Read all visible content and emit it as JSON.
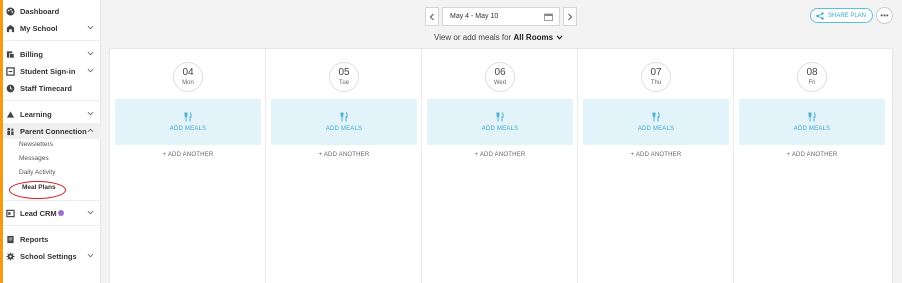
{
  "sidebar": {
    "items": [
      {
        "label": "Dashboard",
        "icon": "palette-icon"
      },
      {
        "label": "My School",
        "icon": "school-icon"
      },
      {
        "label": "Billing",
        "icon": "billing-icon"
      },
      {
        "label": "Student Sign-in",
        "icon": "signin-icon"
      },
      {
        "label": "Staff Timecard",
        "icon": "clock-icon"
      },
      {
        "label": "Learning",
        "icon": "learning-icon"
      },
      {
        "label": "Parent Connection",
        "icon": "family-icon"
      },
      {
        "label": "Lead CRM",
        "icon": "crm-icon"
      },
      {
        "label": "Reports",
        "icon": "reports-icon"
      },
      {
        "label": "School Settings",
        "icon": "gear-icon"
      }
    ],
    "sub_items": [
      "Newsletters",
      "Messages",
      "Daily Activity",
      "Meal Plans"
    ],
    "accent_color": "#f39c12"
  },
  "header": {
    "date_range": "May 4 - May 10",
    "view_prefix": "View or add meals for",
    "room_selection": "All Rooms",
    "share_label": "SHARE PLAN",
    "more_label": "•••"
  },
  "days": [
    {
      "number": "04",
      "name": "Mon"
    },
    {
      "number": "05",
      "name": "Tue"
    },
    {
      "number": "06",
      "name": "Wed"
    },
    {
      "number": "07",
      "name": "Thu"
    },
    {
      "number": "08",
      "name": "Fri"
    }
  ],
  "labels": {
    "add_meals": "ADD MEALS",
    "add_another": "+ ADD ANOTHER"
  },
  "colors": {
    "link": "#3aa7cf",
    "meal_box": "#e2f4fa",
    "annotation": "#d41e1e"
  }
}
